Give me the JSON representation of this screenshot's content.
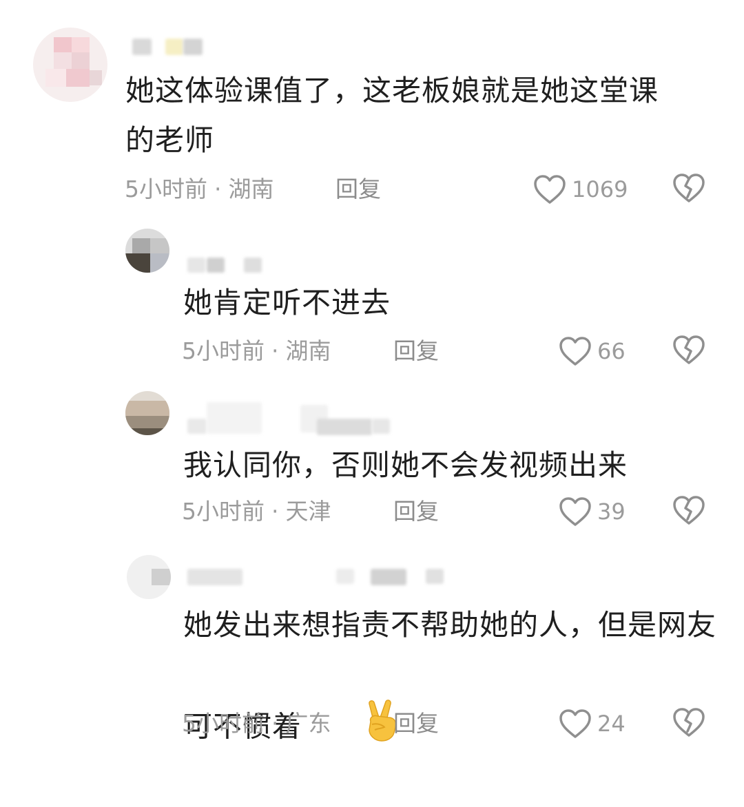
{
  "comments": [
    {
      "text": "她这体验课值了，这老板娘就是她这堂课的老师",
      "time": "5小时前",
      "location": "湖南",
      "reply_label": "回复",
      "likes": "1069"
    },
    {
      "text": "她肯定听不进去",
      "time": "5小时前",
      "location": "湖南",
      "reply_label": "回复",
      "likes": "66"
    },
    {
      "text": "我认同你，否则她不会发视频出来",
      "time": "5小时前",
      "location": "天津",
      "reply_label": "回复",
      "likes": "39"
    },
    {
      "text": "她发出来想指责不帮助她的人，但是网友可不惯着",
      "time": "5小时前",
      "location": "广东",
      "reply_label": "回复",
      "likes": "24"
    }
  ],
  "separator": "·",
  "icons": {
    "like": "heart-outline-icon",
    "dislike": "broken-heart-icon",
    "emoji": "victory-hand-emoji"
  },
  "colors": {
    "text": "#1f1f1f",
    "meta": "#9b9b9b",
    "icon": "#8f8f8f"
  }
}
